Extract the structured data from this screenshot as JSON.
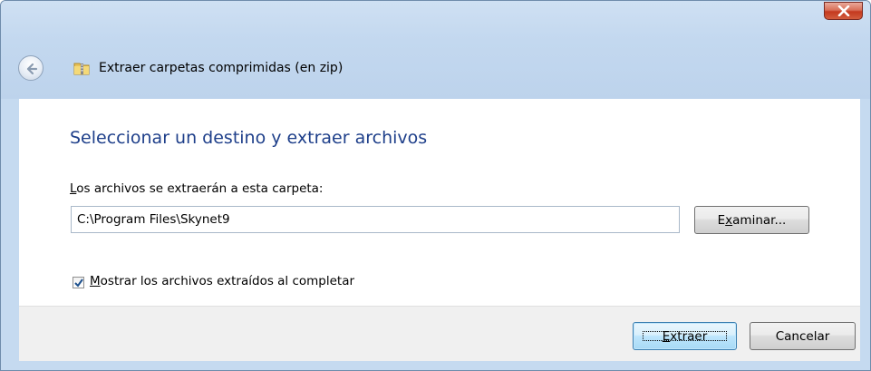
{
  "window": {
    "title": "Extraer carpetas comprimidas (en zip)"
  },
  "icons": {
    "close": "close-icon",
    "back": "back-arrow-icon",
    "folder": "zip-folder-icon",
    "check": "checkmark-icon"
  },
  "content": {
    "heading": "Seleccionar un destino y extraer archivos",
    "label_prefix": "L",
    "label_rest": "os archivos se extraerán a esta carpeta:",
    "path_value": "C:\\Program Files\\Skynet9",
    "browse_prefix": "E",
    "browse_underlined": "x",
    "browse_rest": "aminar...",
    "checkbox_checked": true,
    "checkbox_underlined": "M",
    "checkbox_rest": "ostrar los archivos extraídos al completar"
  },
  "footer": {
    "extract_underlined": "E",
    "extract_rest": "xtraer",
    "cancel_label": "Cancelar"
  },
  "colors": {
    "heading": "#1e3f8a",
    "frame": "#c5daf0",
    "footer": "#f0f0f0",
    "close_button": "#c4391f"
  }
}
